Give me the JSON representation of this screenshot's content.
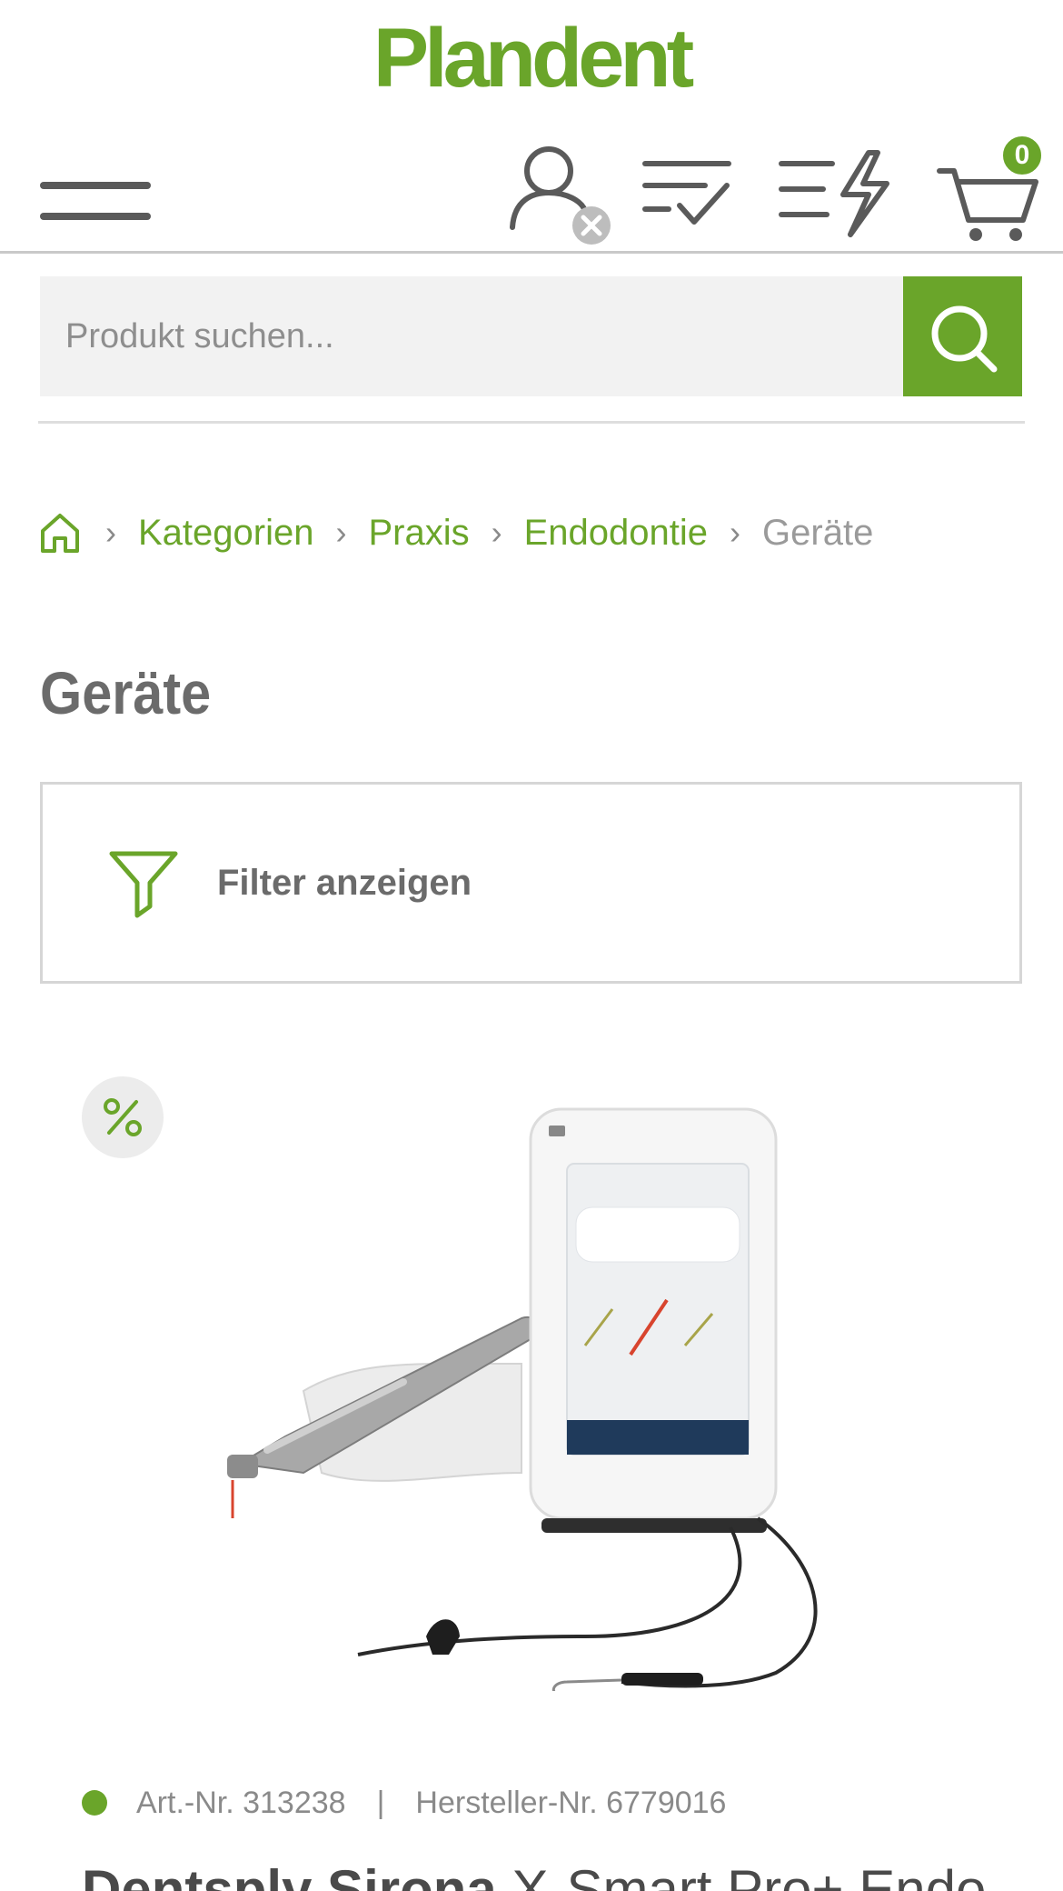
{
  "header": {
    "logo": "Plandent",
    "cart_count": "0"
  },
  "search": {
    "placeholder": "Produkt suchen..."
  },
  "breadcrumb": {
    "items": [
      "Kategorien",
      "Praxis",
      "Endodontie"
    ],
    "current": "Geräte"
  },
  "page": {
    "title": "Geräte"
  },
  "filter": {
    "label": "Filter anzeigen"
  },
  "product": {
    "art_nr": "Art.-Nr. 313238",
    "separator": "|",
    "hersteller_nr": "Hersteller-Nr. 6779016",
    "title_brand": "Dentsply Sirona",
    "title_rest": " X-Smart Pro+ Endo",
    "stock_status_color": "#6aa52a",
    "discount_icon": "percent-icon"
  },
  "colors": {
    "brand_green": "#6aa52a",
    "text_gray": "#6b6b6b"
  },
  "icons": [
    "hamburger-menu-icon",
    "user-icon",
    "wishlist-icon",
    "quick-order-icon",
    "cart-icon",
    "search-icon",
    "home-icon",
    "filter-icon",
    "percent-icon"
  ]
}
